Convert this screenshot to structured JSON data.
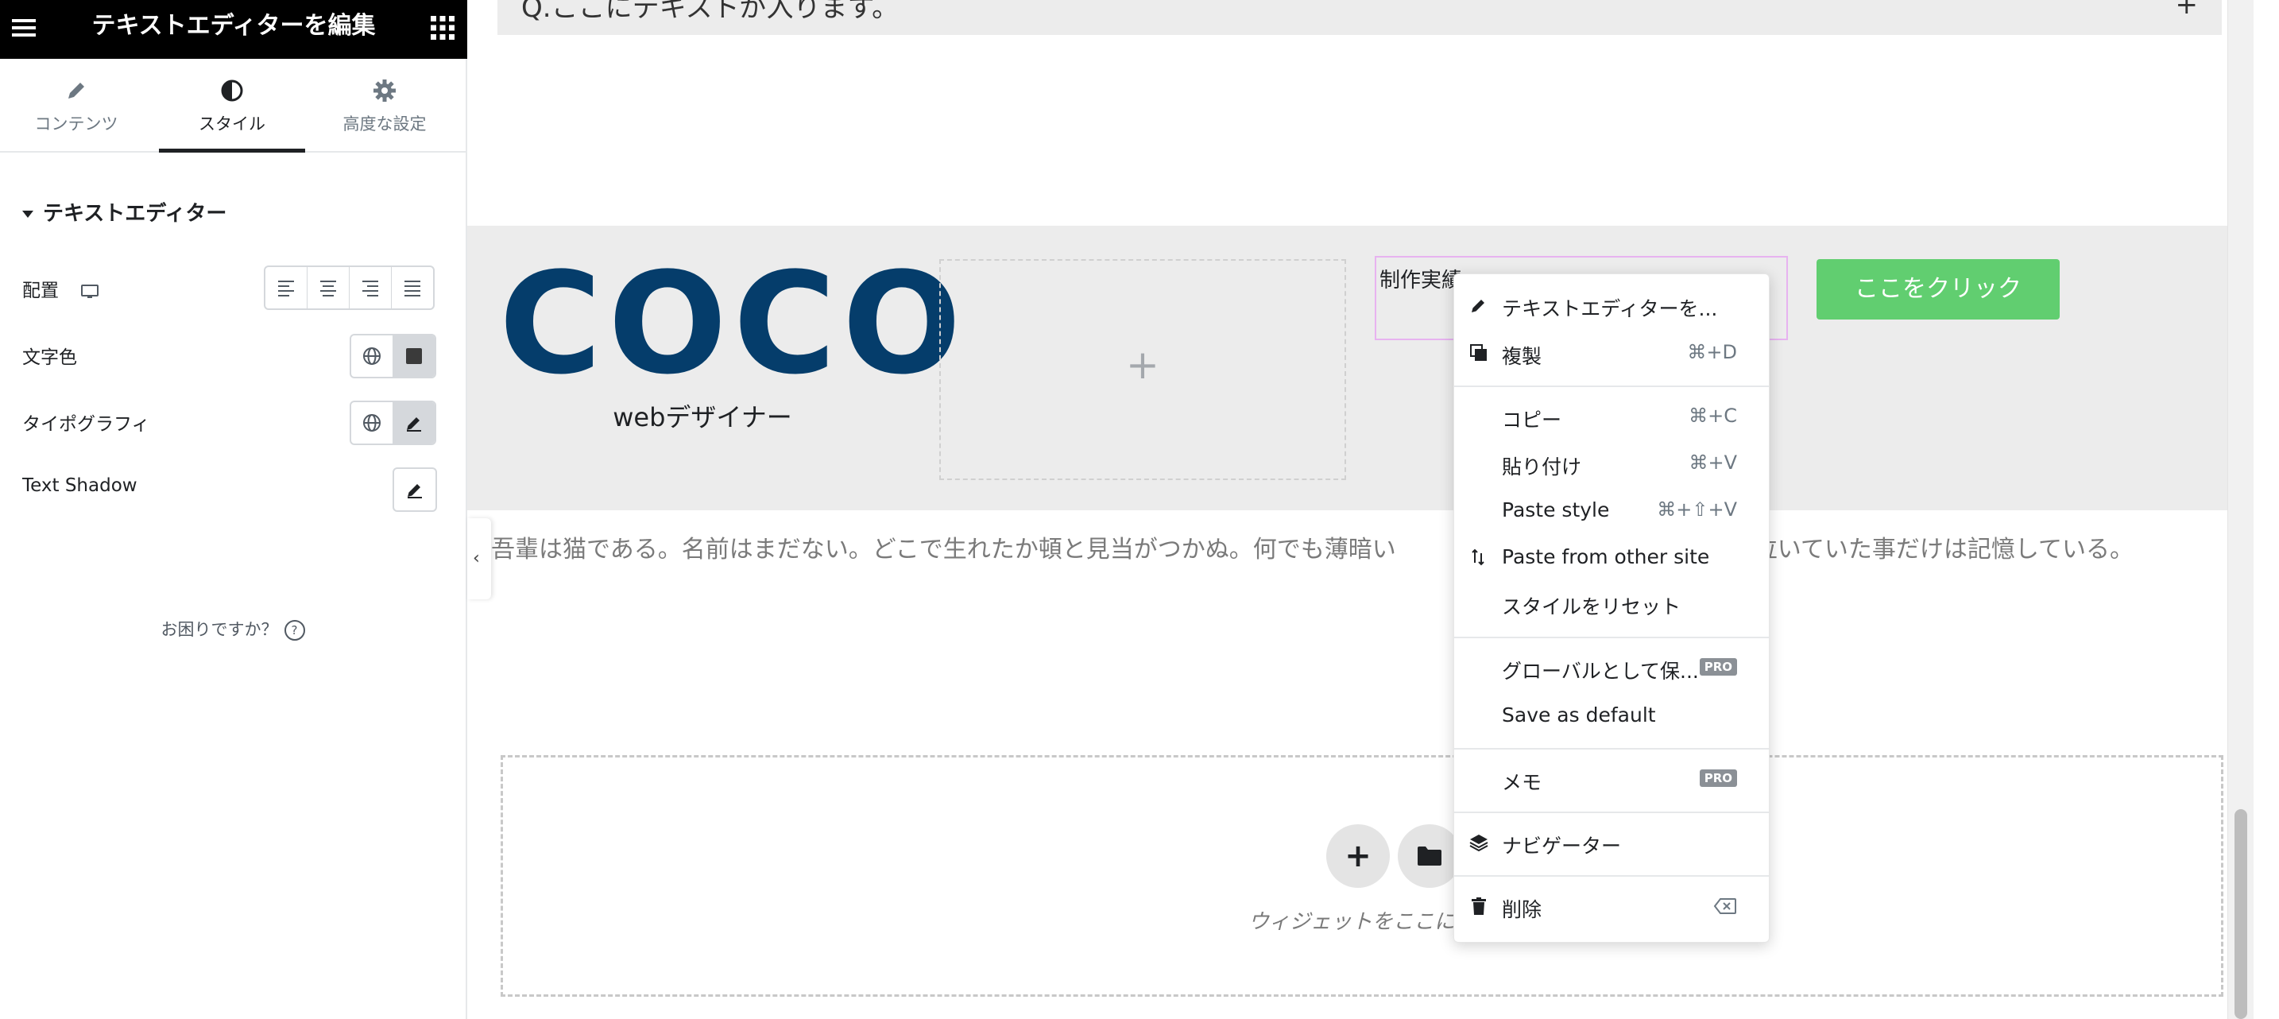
{
  "panel": {
    "title": "テキストエディターを編集",
    "tabs": [
      {
        "label": "コンテンツ",
        "icon": "pencil-icon"
      },
      {
        "label": "スタイル",
        "icon": "contrast-icon"
      },
      {
        "label": "高度な設定",
        "icon": "gear-icon"
      }
    ],
    "section_title": "テキストエディター",
    "controls": {
      "alignment_label": "配置",
      "text_color_label": "文字色",
      "typography_label": "タイポグラフィ",
      "text_shadow_label": "Text Shadow"
    },
    "help_text": "お困りですか？",
    "help_icon": "?"
  },
  "canvas": {
    "faq_question": "Q.ここにテキストが入ります。",
    "faq_plus": "+",
    "logo_text": "COCO",
    "subtitle": "webデザイナー",
    "empty_plus": "+",
    "works_text": "制作実績",
    "cta_label": "ここをクリック",
    "collapse_chevron": "‹",
    "paragraph": "吾輩は猫である。名前はまだない。どこで生れたか頓と見当がつかぬ。何でも薄暗い　　　　　　　　　　　　　ャー泣いていた事だけは記憶している。",
    "dropzone_text": "ウィジェットをここにド",
    "dropzone_plus": "+"
  },
  "context_menu": {
    "items": [
      {
        "label": "テキストエディターを...",
        "icon": "pencil-icon",
        "shortcut": ""
      },
      {
        "label": "複製",
        "icon": "copy-icon",
        "shortcut": "⌘+D"
      },
      {
        "label": "コピー",
        "icon": "",
        "shortcut": "⌘+C"
      },
      {
        "label": "貼り付け",
        "icon": "",
        "shortcut": "⌘+V"
      },
      {
        "label": "Paste style",
        "icon": "",
        "shortcut": "⌘+⇧+V"
      },
      {
        "label": "Paste from other site",
        "icon": "paste-arrows-icon",
        "shortcut": ""
      },
      {
        "label": "スタイルをリセット",
        "icon": "",
        "shortcut": ""
      },
      {
        "label": "グローバルとして保...",
        "icon": "",
        "badge": "PRO"
      },
      {
        "label": "Save as default",
        "icon": "",
        "shortcut": ""
      },
      {
        "label": "メモ",
        "icon": "",
        "badge": "PRO"
      },
      {
        "label": "ナビゲーター",
        "icon": "layers-icon",
        "shortcut": ""
      },
      {
        "label": "削除",
        "icon": "trash-icon",
        "shortcut_icon": "delete-key-icon"
      }
    ]
  },
  "colors": {
    "logo": "#053d6b",
    "cta": "#61ce70",
    "selection_outline": "#e7b3f0",
    "topbar": "#000000"
  }
}
